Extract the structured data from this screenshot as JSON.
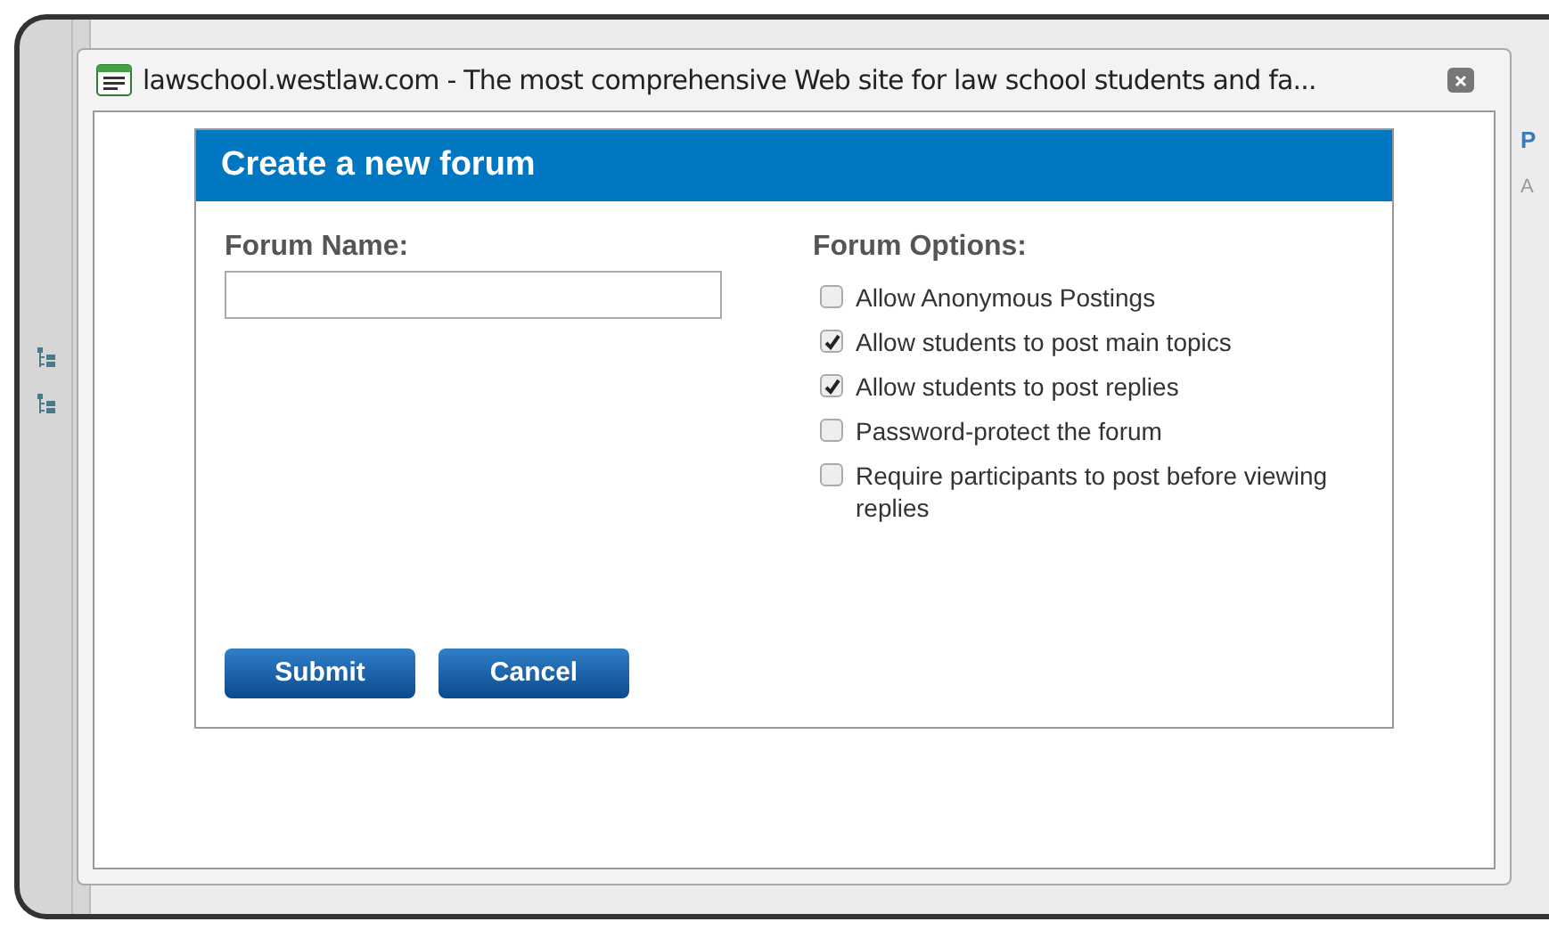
{
  "background": {
    "column_heading": "P",
    "cell_text": "A"
  },
  "window": {
    "title": "lawschool.westlaw.com - The most comprehensive Web site for law school students and fa..."
  },
  "form": {
    "heading": "Create a new forum",
    "name_label": "Forum Name:",
    "options_heading": "Forum Options:",
    "options": [
      {
        "label": "Allow Anonymous Postings",
        "checked": false
      },
      {
        "label": "Allow students to post main topics",
        "checked": true
      },
      {
        "label": "Allow students to post replies",
        "checked": true
      },
      {
        "label": "Password-protect the forum",
        "checked": false
      },
      {
        "label": "Require participants to post before viewing replies",
        "checked": false
      }
    ],
    "buttons": [
      "Submit",
      "Cancel"
    ]
  }
}
